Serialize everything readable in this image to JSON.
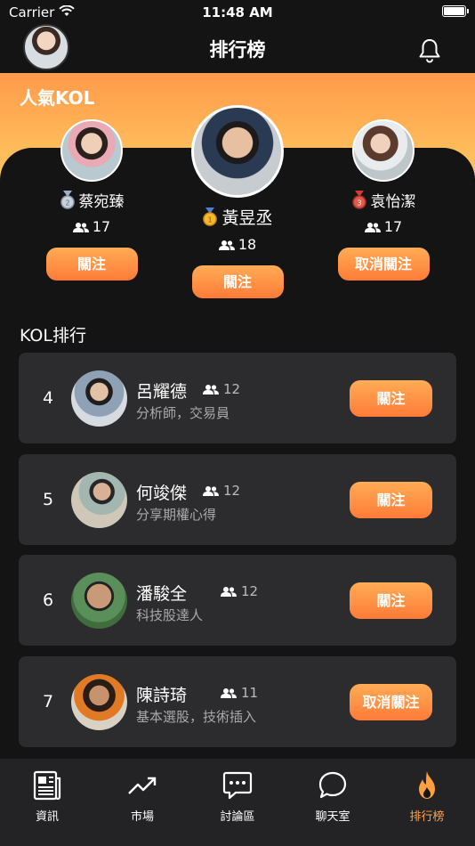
{
  "status": {
    "carrier": "Carrier",
    "time": "11:48 AM"
  },
  "nav": {
    "title": "排行榜"
  },
  "banner": {
    "title": "人氣KOL"
  },
  "podium": [
    {
      "rank": 2,
      "name": "蔡宛臻",
      "fans": "17",
      "button": "關注",
      "medal": "silver-medal-icon"
    },
    {
      "rank": 1,
      "name": "黃昱丞",
      "fans": "18",
      "button": "關注",
      "medal": "gold-medal-icon"
    },
    {
      "rank": 3,
      "name": "袁怡潔",
      "fans": "17",
      "button": "取消關注",
      "medal": "bronze-medal-icon"
    }
  ],
  "list_title": "KOL排行",
  "ranking": [
    {
      "rank": "4",
      "name": "呂耀德",
      "fans": "12",
      "desc": "分析師，交易員",
      "button": "關注"
    },
    {
      "rank": "5",
      "name": "何竣傑",
      "fans": "12",
      "desc": "分享期權心得",
      "button": "關注"
    },
    {
      "rank": "6",
      "name": "潘駿全",
      "fans": "12",
      "desc": "科技股達人",
      "button": "關注"
    },
    {
      "rank": "7",
      "name": "陳詩琦",
      "fans": "11",
      "desc": "基本選股，技術插入",
      "button": "取消關注"
    }
  ],
  "tabs": [
    {
      "label": "資訊",
      "icon": "newspaper-icon"
    },
    {
      "label": "市場",
      "icon": "trend-up-icon"
    },
    {
      "label": "討論區",
      "icon": "comment-dots-icon"
    },
    {
      "label": "聊天室",
      "icon": "chat-bubble-icon"
    },
    {
      "label": "排行榜",
      "icon": "flame-icon",
      "active": true
    }
  ],
  "colors": {
    "accent": "#ff8a3d",
    "accent_light": "#ffb457",
    "card": "#2c2c2e",
    "background": "#141414"
  }
}
